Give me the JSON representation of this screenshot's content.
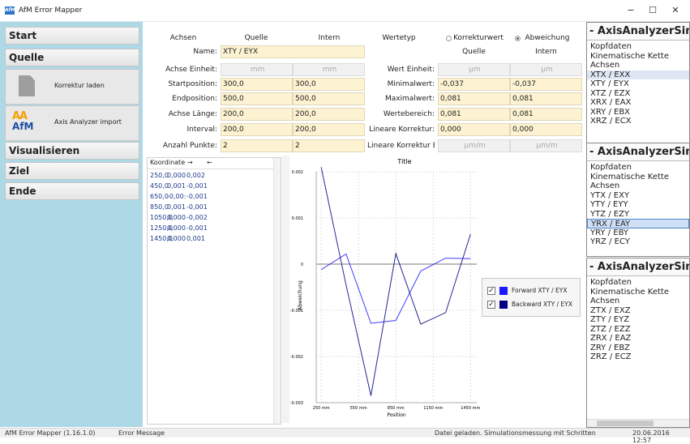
{
  "window": {
    "title": "AfM Error Mapper",
    "minimize": "−",
    "maximize": "☐",
    "close": "✕"
  },
  "sidebar": {
    "start": "Start",
    "quelle": "Quelle",
    "korrektur_laden": "Korrektur laden",
    "axis_import": "Axis Analyzer import",
    "afm_logo_top": "AA",
    "afm_logo_bottom": "AfM",
    "visualisieren": "Visualisieren",
    "ziel": "Ziel",
    "ende": "Ende"
  },
  "form": {
    "col_achsen": "Achsen",
    "col_quelle": "Quelle",
    "col_intern": "Intern",
    "name_label": "Name:",
    "name_value": "XTY / EYX",
    "einheit_label": "Achse Einheit:",
    "einheit_quelle": "mm",
    "einheit_intern": "mm",
    "start_label": "Startposition:",
    "start_quelle": "300,0",
    "start_intern": "300,0",
    "end_label": "Endposition:",
    "end_quelle": "500,0",
    "end_intern": "500,0",
    "laenge_label": "Achse Länge:",
    "laenge_quelle": "200,0",
    "laenge_intern": "200,0",
    "interval_label": "Interval:",
    "interval_quelle": "200,0",
    "interval_intern": "200,0",
    "punkte_label": "Anzahl Punkte:",
    "punkte_quelle": "2",
    "punkte_intern": "2",
    "wertetyp_label": "Wertetyp",
    "radio_korrektur": "Korrekturwert",
    "radio_abweichung": "Abweichung",
    "selected_radio": "Abweichung",
    "r_col_quelle": "Quelle",
    "r_col_intern": "Intern",
    "wert_einheit_label": "Wert Einheit:",
    "wert_einheit_quelle": "µm",
    "wert_einheit_intern": "µm",
    "min_label": "Minimalwert:",
    "min_quelle": "-0,037",
    "min_intern": "-0,037",
    "max_label": "Maximalwert:",
    "max_quelle": "0,081",
    "max_intern": "0,081",
    "bereich_label": "Wertebereich:",
    "bereich_quelle": "0,081",
    "bereich_intern": "0,081",
    "lin_label": "Lineare Korrektur:",
    "lin_quelle": "0,000",
    "lin_intern": "0,000",
    "lin_ein_label": "Lineare Korrektur Ei",
    "lin_ein_quelle": "µm/m",
    "lin_ein_intern": "µm/m"
  },
  "grid": {
    "headers": [
      "Koordinate",
      "→",
      "←"
    ],
    "rows": [
      [
        "250,0",
        "0,000",
        "0,002"
      ],
      [
        "450,0",
        "0,001",
        "-0,001"
      ],
      [
        "650,0",
        "-0,00:",
        "-0,001"
      ],
      [
        "850,0",
        "0,001",
        "-0,001"
      ],
      [
        "1050,0",
        "0,000",
        "-0,002"
      ],
      [
        "1250,0",
        "0,000",
        "-0,001"
      ],
      [
        "1450,0",
        "0,000",
        "0,001"
      ]
    ]
  },
  "chart_data": {
    "type": "line",
    "title": "Title",
    "xlabel": "Position",
    "ylabel": "Abweichung",
    "x_tick_labels": [
      "250 mm",
      "550 mm",
      "850 mm",
      "1150 mm",
      "1450 mm"
    ],
    "x_ticks": [
      250,
      550,
      850,
      1150,
      1450
    ],
    "y_tick_labels": [
      "0.002",
      "0.001",
      "0",
      "-0.001",
      "-0.002",
      "-0.003"
    ],
    "y_ticks": [
      0.002,
      0.001,
      0,
      -0.001,
      -0.002,
      -0.003
    ],
    "xlim": [
      210,
      1500
    ],
    "ylim": [
      -0.003,
      0.002
    ],
    "grid": true,
    "series": [
      {
        "name": "Forward XTY / EYX",
        "color": "#1a1aff",
        "x": [
          250,
          450,
          650,
          850,
          1050,
          1250,
          1450
        ],
        "y": [
          -0.00012,
          0.00022,
          -0.00128,
          -0.00122,
          -0.00015,
          0.00013,
          0.00012
        ]
      },
      {
        "name": "Backward XTY / EYX",
        "color": "#000080",
        "x": [
          250,
          450,
          650,
          850,
          1050,
          1250,
          1450
        ],
        "y": [
          0.0021,
          -0.00045,
          -0.00285,
          0.00023,
          -0.0013,
          -0.00105,
          0.00065
        ]
      }
    ],
    "legend": "right"
  },
  "legend": {
    "forward_label": "Forward XTY / EYX",
    "backward_label": "Backward XTY / EYX",
    "forward_color": "#1a1aff",
    "backward_color": "#000080"
  },
  "right_panels": [
    {
      "title": "- AxisAnalyzerSimu",
      "items": [
        "Kopfdaten",
        "Kinematische Kette",
        "Achsen",
        "XTX / EXX",
        "XTY / EYX",
        "XTZ / EZX",
        "XRX / EAX",
        "XRY / EBX",
        "XRZ / ECX"
      ]
    },
    {
      "title": "- AxisAnalyzerSimu",
      "items": [
        "Kopfdaten",
        "Kinematische Kette",
        "Achsen",
        "YTX / EXY",
        "YTY / EYY",
        "YTZ / EZY",
        "YRX / EAY",
        "YRY / EBY",
        "YRZ / ECY"
      ]
    },
    {
      "title": "- AxisAnalyzerSimu",
      "items": [
        "Kopfdaten",
        "Kinematische Kette",
        "Achsen",
        "ZTX / EXZ",
        "ZTY / EYZ",
        "ZTZ / EZZ",
        "ZRX / EAZ",
        "ZRY / EBZ",
        "ZRZ / ECZ"
      ]
    }
  ],
  "status": {
    "app_version": "AfM Error Mapper (1.16.1.0)",
    "message_label": "Error Message",
    "info": "Datei geladen. Simulationsmessung mit Schritten",
    "datetime": "20.06.2016 12:57"
  }
}
